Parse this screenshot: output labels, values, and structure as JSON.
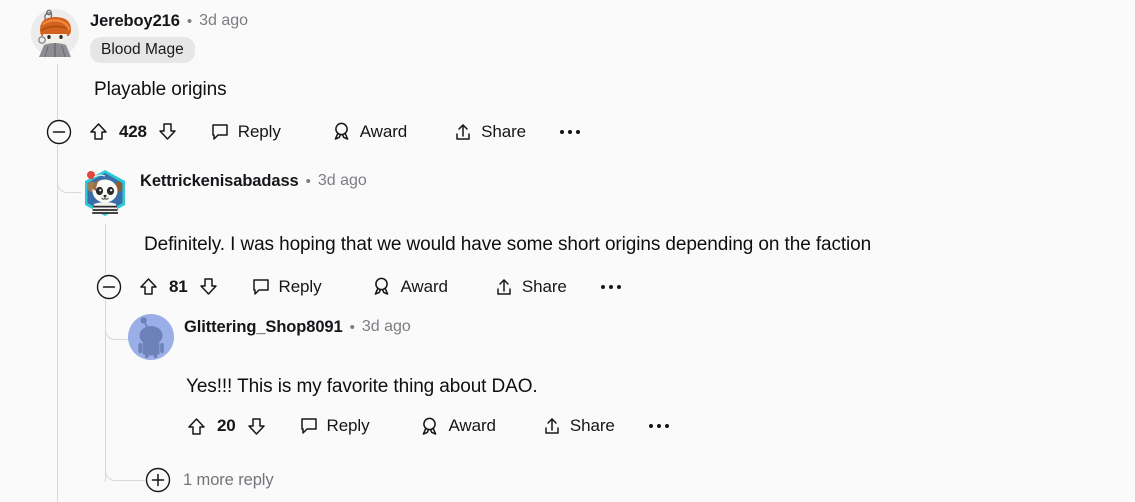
{
  "thread": {
    "comments": [
      {
        "id": "l1",
        "username": "Jereboy216",
        "separator": "•",
        "timestamp": "3d ago",
        "flair": "Blood Mage",
        "body": "Playable origins",
        "votes": "428",
        "actions": {
          "collapse": "collapse-comment",
          "upvote": "upvote",
          "downvote": "downvote",
          "reply": "Reply",
          "award": "Award",
          "share": "Share",
          "more": "more-options"
        }
      },
      {
        "id": "l2",
        "username": "Kettrickenisabadass",
        "separator": "•",
        "timestamp": "3d ago",
        "body": "Definitely. I was hoping that we would have some short origins depending on the faction",
        "votes": "81",
        "actions": {
          "collapse": "collapse-comment",
          "upvote": "upvote",
          "downvote": "downvote",
          "reply": "Reply",
          "award": "Award",
          "share": "Share",
          "more": "more-options"
        }
      },
      {
        "id": "l3",
        "username": "Glittering_Shop8091",
        "separator": "•",
        "timestamp": "3d ago",
        "body": "Yes!!! This is my favorite thing about DAO.",
        "votes": "20",
        "actions": {
          "upvote": "upvote",
          "downvote": "downvote",
          "reply": "Reply",
          "award": "Award",
          "share": "Share",
          "more": "more-options"
        }
      }
    ],
    "more_replies": {
      "label": "1 more reply",
      "icon": "plus-circle-icon"
    }
  },
  "colors": {
    "background": "#fafafa",
    "text": "#0f0f10",
    "muted": "#7c7c83",
    "flair_bg": "#e6e6e6",
    "thread_line": "#d8d8d8",
    "snoo_blue": "#9aaee8",
    "snoo_body": "#6e80b8"
  }
}
